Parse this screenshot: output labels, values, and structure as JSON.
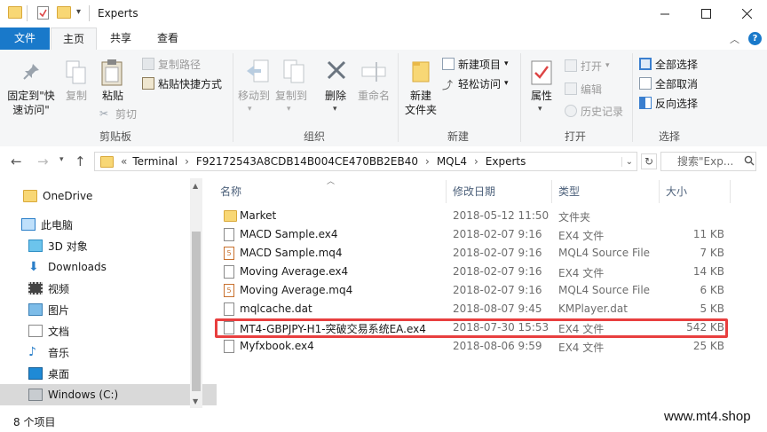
{
  "window": {
    "title": "Experts"
  },
  "ribbon_tabs": [
    "文件",
    "主页",
    "共享",
    "查看"
  ],
  "ribbon": {
    "clipboard": {
      "pin_label_1": "固定到\"快",
      "pin_label_2": "速访问\"",
      "copy_label": "复制",
      "paste_label": "粘贴",
      "copy_path_label": "复制路径",
      "paste_shortcut_label": "粘贴快捷方式",
      "cut_label": "剪切",
      "group_label": "剪贴板"
    },
    "organize": {
      "move_to_label": "移动到",
      "copy_to_label": "复制到",
      "delete_label": "删除",
      "rename_label": "重命名",
      "group_label": "组织"
    },
    "new": {
      "new_folder_label_1": "新建",
      "new_folder_label_2": "文件夹",
      "new_item_label": "新建项目",
      "easy_access_label": "轻松访问",
      "group_label": "新建"
    },
    "open": {
      "properties_label": "属性",
      "open_label": "打开",
      "edit_label": "编辑",
      "history_label": "历史记录",
      "group_label": "打开"
    },
    "select": {
      "select_all_label": "全部选择",
      "select_none_label": "全部取消",
      "invert_label": "反向选择",
      "group_label": "选择"
    }
  },
  "address": {
    "prefix": "«",
    "crumbs": [
      "Terminal",
      "F92172543A8CDB14B004CE470BB2EB40",
      "MQL4",
      "Experts"
    ],
    "search_placeholder": "搜索\"Exp..."
  },
  "nav_pane": [
    {
      "label": "OneDrive",
      "icon": "onedrive-folder-icon"
    },
    {
      "label": "此电脑",
      "icon": "computer-icon"
    },
    {
      "label": "3D 对象",
      "icon": "3d-objects-icon"
    },
    {
      "label": "Downloads",
      "icon": "download-icon"
    },
    {
      "label": "视频",
      "icon": "video-icon"
    },
    {
      "label": "图片",
      "icon": "pictures-icon"
    },
    {
      "label": "文档",
      "icon": "documents-icon"
    },
    {
      "label": "音乐",
      "icon": "music-icon"
    },
    {
      "label": "桌面",
      "icon": "desktop-icon"
    },
    {
      "label": "Windows (C:)",
      "icon": "drive-icon"
    }
  ],
  "columns": {
    "name": "名称",
    "date": "修改日期",
    "type": "类型",
    "size": "大小"
  },
  "files": [
    {
      "name": "Market",
      "date": "2018-05-12 11:50",
      "type": "文件夹",
      "size": "",
      "icon": "folder"
    },
    {
      "name": "MACD Sample.ex4",
      "date": "2018-02-07 9:16",
      "type": "EX4 文件",
      "size": "11 KB",
      "icon": "doc"
    },
    {
      "name": "MACD Sample.mq4",
      "date": "2018-02-07 9:16",
      "type": "MQL4 Source File",
      "size": "7 KB",
      "icon": "mq4"
    },
    {
      "name": "Moving Average.ex4",
      "date": "2018-02-07 9:16",
      "type": "EX4 文件",
      "size": "14 KB",
      "icon": "doc"
    },
    {
      "name": "Moving Average.mq4",
      "date": "2018-02-07 9:16",
      "type": "MQL4 Source File",
      "size": "6 KB",
      "icon": "mq4"
    },
    {
      "name": "mqlcache.dat",
      "date": "2018-08-07 9:45",
      "type": "KMPlayer.dat",
      "size": "5 KB",
      "icon": "doc"
    },
    {
      "name": "MT4-GBPJPY-H1-突破交易系统EA.ex4",
      "date": "2018-07-30 15:53",
      "type": "EX4 文件",
      "size": "542 KB",
      "icon": "doc"
    },
    {
      "name": "Myfxbook.ex4",
      "date": "2018-08-06 9:59",
      "type": "EX4 文件",
      "size": "25 KB",
      "icon": "doc"
    }
  ],
  "status": {
    "count": "8 个项目"
  },
  "watermark": "www.mt4.shop",
  "colors": {
    "accent": "#1979ca",
    "highlight": "#e83f3f",
    "folder": "#f8d775"
  }
}
